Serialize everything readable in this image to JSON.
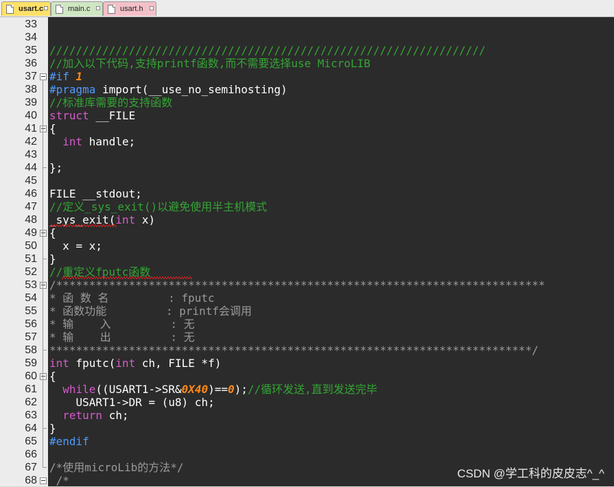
{
  "tabs": [
    {
      "label": "usart.c",
      "active": true,
      "color": "#ffe169"
    },
    {
      "label": "main.c",
      "active": false,
      "color": "#cfe6c3"
    },
    {
      "label": "usart.h",
      "active": false,
      "color": "#f3c0c8"
    }
  ],
  "colors": {
    "editor_bg": "#2b2b2b",
    "comment": "#34a534",
    "keyword": "#d65acb",
    "preprocessor": "#4f9bff",
    "number": "#ff8a1a",
    "plain": "#ffffff"
  },
  "lines": [
    {
      "n": "33",
      "segs": []
    },
    {
      "n": "34",
      "segs": []
    },
    {
      "n": "35",
      "segs": [
        {
          "t": "//////////////////////////////////////////////////////////////////",
          "c": "cm"
        }
      ]
    },
    {
      "n": "36",
      "segs": [
        {
          "t": "//加入以下代码,支持printf函数,而不需要选择use MicroLIB",
          "c": "cm"
        }
      ]
    },
    {
      "n": "37",
      "fold": true,
      "segs": [
        {
          "t": "#if ",
          "c": "pp"
        },
        {
          "t": "1",
          "c": "num"
        }
      ]
    },
    {
      "n": "38",
      "segs": [
        {
          "t": "#pragma ",
          "c": "pp"
        },
        {
          "t": "import(__use_no_semihosting)",
          "c": "pl"
        }
      ]
    },
    {
      "n": "39",
      "segs": [
        {
          "t": "//标准库需要的支持函数",
          "c": "cm"
        }
      ]
    },
    {
      "n": "40",
      "segs": [
        {
          "t": "struct ",
          "c": "kw"
        },
        {
          "t": "__FILE",
          "c": "pl"
        }
      ]
    },
    {
      "n": "41",
      "fold": true,
      "segs": [
        {
          "t": "{",
          "c": "pl"
        }
      ]
    },
    {
      "n": "42",
      "segs": [
        {
          "t": "  ",
          "c": "pl"
        },
        {
          "t": "int ",
          "c": "kw"
        },
        {
          "t": "handle;",
          "c": "pl"
        }
      ]
    },
    {
      "n": "43",
      "segs": []
    },
    {
      "n": "44",
      "segs": [
        {
          "t": "};",
          "c": "pl"
        }
      ]
    },
    {
      "n": "45",
      "segs": []
    },
    {
      "n": "46",
      "segs": [
        {
          "t": "FILE __stdout;",
          "c": "pl"
        }
      ]
    },
    {
      "n": "47",
      "segs": [
        {
          "t": "//定义_sys_exit()以避免使用半主机模式",
          "c": "cm"
        }
      ]
    },
    {
      "n": "48",
      "segs": [
        {
          "t": "_sys_exit",
          "c": "pl"
        },
        {
          "t": "(",
          "c": "pl"
        },
        {
          "t": "int ",
          "c": "kw"
        },
        {
          "t": "x)",
          "c": "pl"
        }
      ]
    },
    {
      "n": "49",
      "fold": true,
      "segs": [
        {
          "t": "{",
          "c": "pl"
        }
      ]
    },
    {
      "n": "50",
      "segs": [
        {
          "t": "  x = x;",
          "c": "pl"
        }
      ]
    },
    {
      "n": "51",
      "segs": [
        {
          "t": "}",
          "c": "pl"
        }
      ]
    },
    {
      "n": "52",
      "segs": [
        {
          "t": "//重定义fputc函数",
          "c": "cm"
        }
      ]
    },
    {
      "n": "53",
      "fold": true,
      "segs": [
        {
          "t": "/**************************************************************************",
          "c": "cmg"
        }
      ]
    },
    {
      "n": "54",
      "segs": [
        {
          "t": "* 函 数 名         : fputc",
          "c": "cmg"
        }
      ]
    },
    {
      "n": "55",
      "segs": [
        {
          "t": "* 函数功能         : printf会调用",
          "c": "cmg"
        }
      ]
    },
    {
      "n": "56",
      "segs": [
        {
          "t": "* 输    入         : 无",
          "c": "cmg"
        }
      ]
    },
    {
      "n": "57",
      "segs": [
        {
          "t": "* 输    出         : 无",
          "c": "cmg"
        }
      ]
    },
    {
      "n": "58",
      "segs": [
        {
          "t": "*************************************************************************/",
          "c": "cmg"
        }
      ]
    },
    {
      "n": "59",
      "segs": [
        {
          "t": "int ",
          "c": "kw"
        },
        {
          "t": "fputc(",
          "c": "pl"
        },
        {
          "t": "int ",
          "c": "kw"
        },
        {
          "t": "ch, FILE *f)",
          "c": "pl"
        }
      ]
    },
    {
      "n": "60",
      "fold": true,
      "segs": [
        {
          "t": "{",
          "c": "pl"
        }
      ]
    },
    {
      "n": "61",
      "segs": [
        {
          "t": "  ",
          "c": "pl"
        },
        {
          "t": "while",
          "c": "kw"
        },
        {
          "t": "((USART1->SR&",
          "c": "pl"
        },
        {
          "t": "0X40",
          "c": "num"
        },
        {
          "t": ")==",
          "c": "pl"
        },
        {
          "t": "0",
          "c": "num"
        },
        {
          "t": ");",
          "c": "pl"
        },
        {
          "t": "//循环发送,直到发送完毕",
          "c": "cm"
        }
      ]
    },
    {
      "n": "62",
      "segs": [
        {
          "t": "    USART1->DR = (u8) ch;",
          "c": "pl"
        }
      ]
    },
    {
      "n": "63",
      "segs": [
        {
          "t": "  ",
          "c": "pl"
        },
        {
          "t": "return ",
          "c": "kw"
        },
        {
          "t": "ch;",
          "c": "pl"
        }
      ]
    },
    {
      "n": "64",
      "segs": [
        {
          "t": "}",
          "c": "pl"
        }
      ]
    },
    {
      "n": "65",
      "segs": [
        {
          "t": "#endif",
          "c": "pp"
        }
      ]
    },
    {
      "n": "66",
      "segs": []
    },
    {
      "n": "67",
      "segs": [
        {
          "t": "/*使用microLib的方法*/",
          "c": "cmg"
        }
      ]
    },
    {
      "n": "68",
      "fold": true,
      "segs": [
        {
          "t": " /*",
          "c": "cmg"
        }
      ]
    }
  ],
  "watermark": "CSDN @学工科的皮皮志^_^"
}
